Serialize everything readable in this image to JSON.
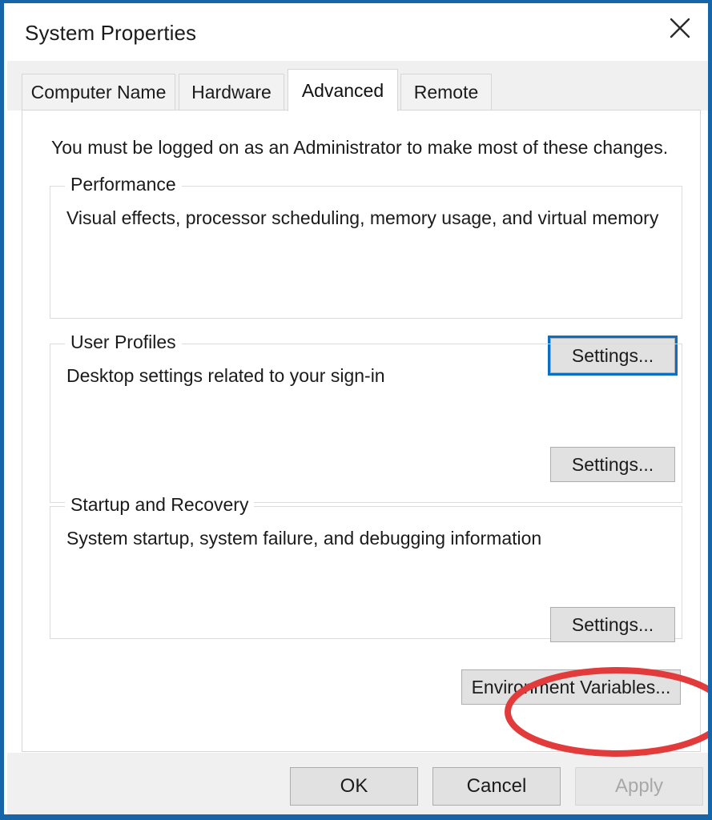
{
  "window": {
    "title": "System Properties",
    "close_icon": "close-icon",
    "border_color": "#1565a8"
  },
  "tabs": [
    {
      "label": "Computer Name",
      "selected": false
    },
    {
      "label": "Hardware",
      "selected": false
    },
    {
      "label": "Advanced",
      "selected": true
    },
    {
      "label": "Remote",
      "selected": false
    }
  ],
  "panel": {
    "admin_note": "You must be logged on as an Administrator to make most of these changes.",
    "groups": [
      {
        "label": "Performance",
        "description": "Visual effects, processor scheduling, memory usage, and virtual memory",
        "button_label": "Settings...",
        "focused": true
      },
      {
        "label": "User Profiles",
        "description": "Desktop settings related to your sign-in",
        "button_label": "Settings...",
        "focused": false
      },
      {
        "label": "Startup and Recovery",
        "description": "System startup, system failure, and debugging information",
        "button_label": "Settings...",
        "focused": false,
        "annotated": true
      }
    ],
    "environment_variables_label": "Environment Variables..."
  },
  "footer": {
    "ok_label": "OK",
    "cancel_label": "Cancel",
    "apply_label": "Apply",
    "apply_disabled": true
  },
  "annotation": {
    "shape": "ellipse",
    "color": "#e23b3b",
    "stroke_width": 8,
    "targets": "startup-and-recovery-settings-button"
  },
  "colors": {
    "focus_ring": "#0a6fc2",
    "window_border": "#1565a8",
    "button_face": "#e1e1e1",
    "footer_background": "#f0f0f0",
    "panel_background": "#ffffff",
    "annotation_red": "#e23b3b"
  }
}
